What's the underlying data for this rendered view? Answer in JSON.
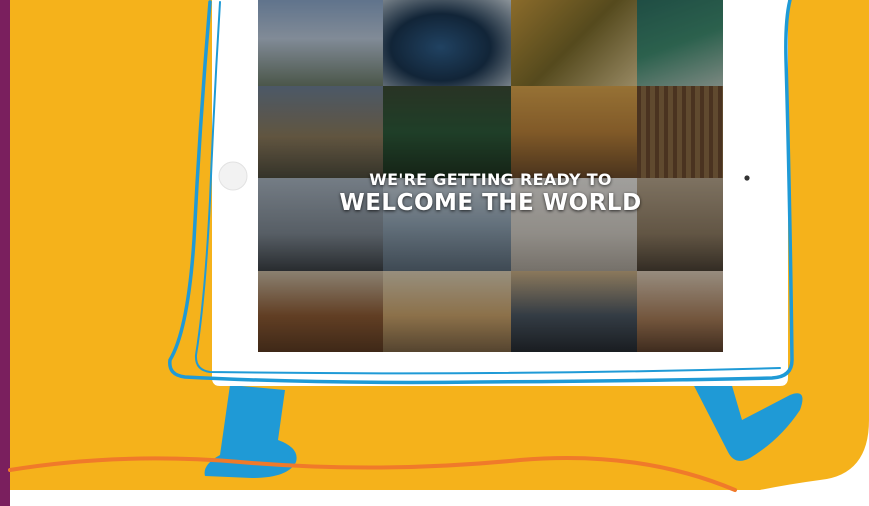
{
  "headline": {
    "line1": "WE'RE GETTING READY TO",
    "line2": "WELCOME THE WORLD"
  },
  "colors": {
    "background_yellow": "#f5b21b",
    "accent_purple": "#7a1f5e",
    "outline_blue": "#1f9ad6",
    "tablet_white": "#ffffff",
    "wave_orange": "#f07a2a"
  },
  "icons": {
    "home_button": "tablet-home-button-icon",
    "camera": "tablet-camera-icon"
  }
}
